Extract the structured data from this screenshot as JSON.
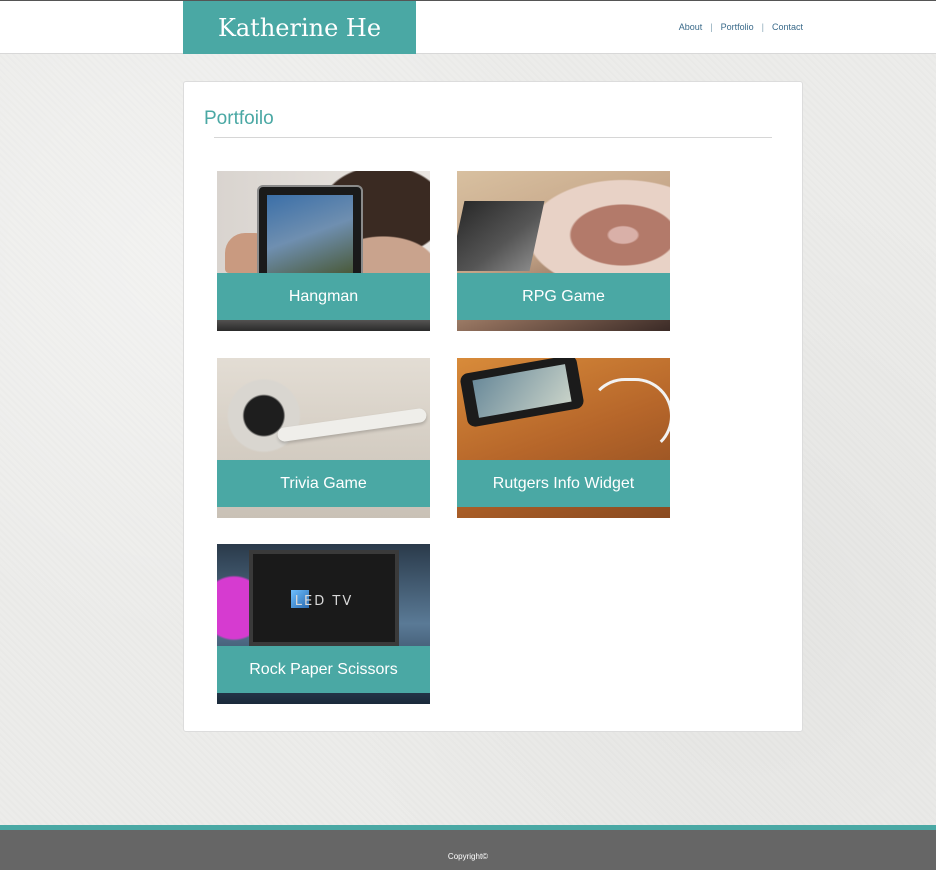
{
  "header": {
    "brand": "Katherine He",
    "nav": [
      {
        "label": "About"
      },
      {
        "label": "Portfolio"
      },
      {
        "label": "Contact"
      }
    ],
    "separator": "|"
  },
  "portfolio": {
    "title": "Portfoilo",
    "items": [
      {
        "label": "Hangman",
        "image": "tablet-photo"
      },
      {
        "label": "RPG Game",
        "image": "turntable-photo"
      },
      {
        "label": "Trivia Game",
        "image": "earbuds-photo"
      },
      {
        "label": "Rutgers Info Widget",
        "image": "smartphone-photo"
      },
      {
        "label": "Rock Paper Scissors",
        "image": "led-tv-photo",
        "image_text": "LED TV"
      }
    ]
  },
  "footer": {
    "copyright": "Copyright©"
  },
  "colors": {
    "accent": "#4aa8a4",
    "footer_bg": "#666666",
    "page_bg": "#ececea",
    "nav_link": "#3a6a8a"
  }
}
